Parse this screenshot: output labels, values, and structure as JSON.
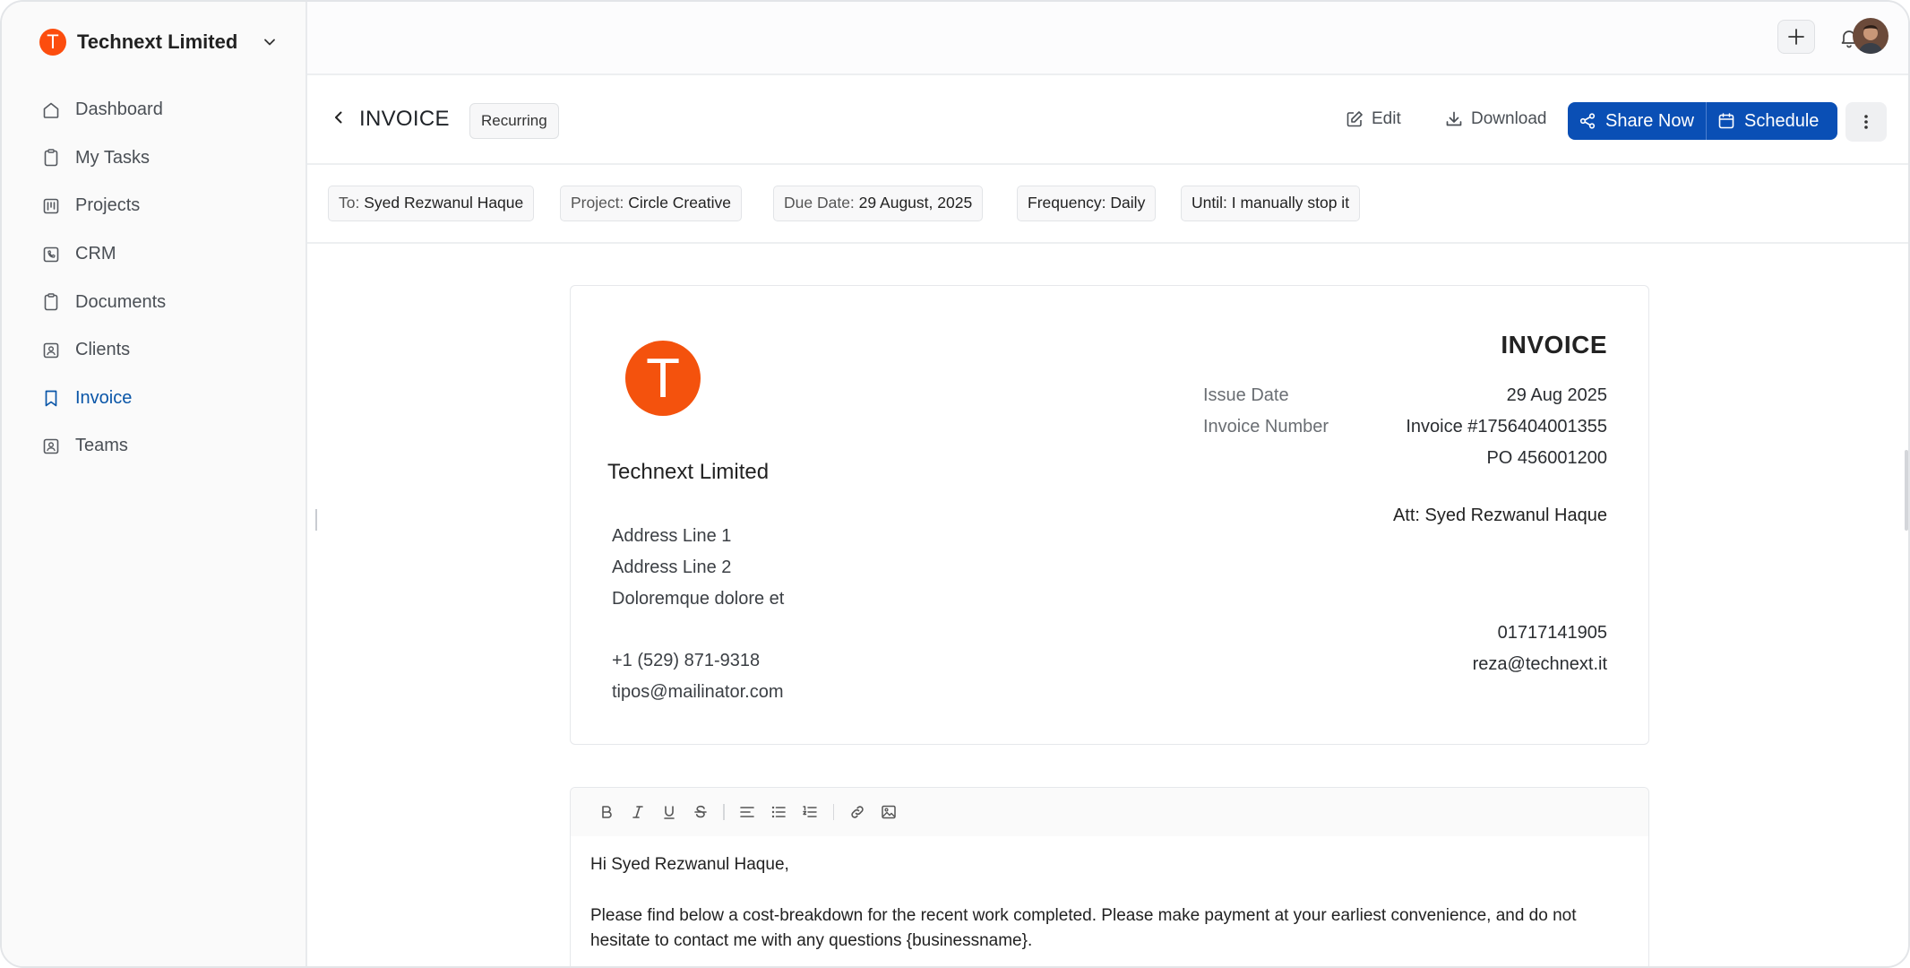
{
  "workspace": {
    "name": "Technext Limited",
    "logo_letter": "T"
  },
  "sidebar": {
    "items": [
      {
        "label": "Dashboard",
        "icon": "home-icon"
      },
      {
        "label": "My Tasks",
        "icon": "clipboard-icon"
      },
      {
        "label": "Projects",
        "icon": "kanban-icon"
      },
      {
        "label": "CRM",
        "icon": "phone-icon"
      },
      {
        "label": "Documents",
        "icon": "document-icon"
      },
      {
        "label": "Clients",
        "icon": "contact-icon"
      },
      {
        "label": "Invoice",
        "icon": "bookmark-icon",
        "active": true
      },
      {
        "label": "Teams",
        "icon": "team-icon"
      }
    ]
  },
  "header": {
    "title": "INVOICE",
    "badge": "Recurring",
    "actions": {
      "edit": "Edit",
      "download": "Download",
      "share": "Share Now",
      "schedule": "Schedule"
    }
  },
  "meta": {
    "to_label": "To:",
    "to": "Syed Rezwanul Haque",
    "project_label": "Project:",
    "project": "Circle Creative",
    "due_label": "Due Date:",
    "due": "29 August, 2025",
    "frequency_label": "Frequency:",
    "frequency": "Daily",
    "until_label": "Until:",
    "until": "I manually stop it"
  },
  "invoice": {
    "logo_letter": "T",
    "company": "Technext Limited",
    "address": [
      "Address Line 1",
      "Address Line 2",
      "Doloremque dolore et"
    ],
    "phone": "+1 (529) 871-9318",
    "email": "tipos@mailinator.com",
    "title": "INVOICE",
    "issue_date_label": "Issue Date",
    "issue_date": "29 Aug 2025",
    "invoice_number_label": "Invoice Number",
    "invoice_number": "Invoice #1756404001355",
    "po": "PO 456001200",
    "attention": "Att: Syed Rezwanul Haque",
    "client_phone": "01717141905",
    "client_email": "reza@technext.it"
  },
  "editor": {
    "greeting": "Hi Syed Rezwanul Haque,",
    "message": "Please find below a cost-breakdown for the recent work completed. Please make payment at your earliest convenience, and do not hesitate to contact me with any questions {businessname}."
  },
  "colors": {
    "accent": "#0A4FB5",
    "brand_orange": "#F4520D",
    "active_nav": "#0A56A8"
  }
}
